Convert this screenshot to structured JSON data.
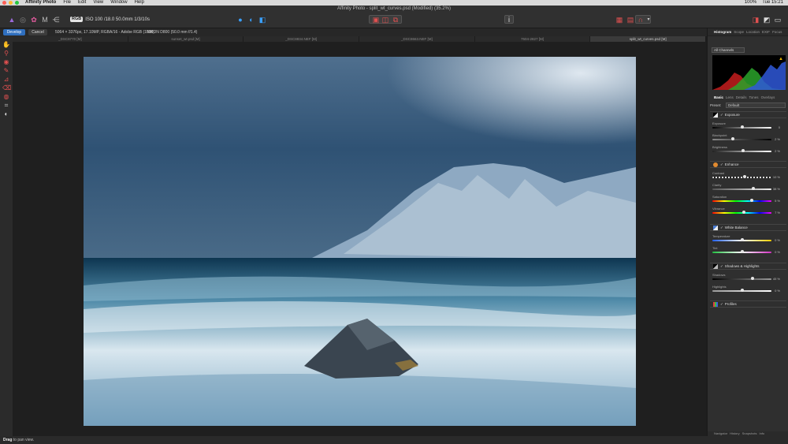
{
  "colors": {
    "accent": "#2f6fbf",
    "close": "#ff5f57",
    "minimize": "#febc2e",
    "zoom": "#28c840"
  },
  "menubar": {
    "app_name": "Affinity Photo",
    "items": [
      "File",
      "Edit",
      "View",
      "Window",
      "Help"
    ],
    "battery": "100%",
    "clock": "Tue 15:21"
  },
  "window": {
    "title": "Affinity Photo - split_wt_curves.psd (Modified) (35.2%)"
  },
  "toolbar": {
    "color_badge": "RGB",
    "exif": "ISO 100 /18.0 50.0mm 1/3/10s"
  },
  "context": {
    "develop_label": "Develop",
    "cancel_label": "Cancel",
    "image_info": "5064 × 3376px, 17.10MP, RGBA/16 - Adobe RGB (1998)",
    "camera_info": "NIKON D800 (50.0 mm f/1.4)"
  },
  "tabs": [
    {
      "label": "_DSC8770 [M]"
    },
    {
      "label": "sunset_wt.psd [M]"
    },
    {
      "label": "_DSC8834.NEF [M]"
    },
    {
      "label": "_DSC8663.NEF [M]"
    },
    {
      "label": "7504-2827 [M]"
    },
    {
      "label": "split_wt_curves.psd [M]"
    }
  ],
  "statusbar": {
    "bold": "Drag",
    "text": " to pan view."
  },
  "panel": {
    "top_tabs": [
      "Histogram",
      "Scope",
      "Location",
      "EXIF",
      "Focus"
    ],
    "channels": "All Channels",
    "dev_tabs": [
      "Basic",
      "Lens",
      "Details",
      "Tones",
      "Overlays"
    ],
    "preset_label": "Preset:",
    "preset_value": "Default",
    "sections": [
      {
        "name": "Exposure",
        "swatch": "#e0e0e0",
        "sliders": [
          {
            "label": "Exposure",
            "value": "0",
            "pos": 0.5,
            "grad": "linear-gradient(90deg,#000,#fff)"
          },
          {
            "label": "Blackpoint",
            "value": "2 %",
            "pos": 0.35,
            "grad": "linear-gradient(90deg,#888,#000)"
          },
          {
            "label": "Brightness",
            "value": "2 %",
            "pos": 0.52,
            "grad": "linear-gradient(90deg,#222,#fff)"
          }
        ]
      },
      {
        "name": "Enhance",
        "swatch": "#e08a30",
        "sliders": [
          {
            "label": "Contrast",
            "value": "10 %",
            "pos": 0.55,
            "grad": "repeating-linear-gradient(90deg,#ddd 0 2px,#222 2px 4px)"
          },
          {
            "label": "Clarity",
            "value": "38 %",
            "pos": 0.69,
            "grad": "linear-gradient(90deg,#555,#eee)"
          },
          {
            "label": "Saturation",
            "value": "5 %",
            "pos": 0.67,
            "grad": "linear-gradient(90deg,#f00,#ff0,#0f0,#0ff,#00f,#f0f)"
          },
          {
            "label": "Vibrance",
            "value": "7 %",
            "pos": 0.53,
            "grad": "linear-gradient(90deg,#f00,#ff0,#0f0,#0ff,#00f,#f0f)"
          }
        ]
      },
      {
        "name": "White Balance",
        "swatch": "#d0d8e8",
        "sliders": [
          {
            "label": "Temperature",
            "value": "0 %",
            "pos": 0.5,
            "grad": "linear-gradient(90deg,#2060ff,#fff,#ffd000)"
          },
          {
            "label": "Tint",
            "value": "0 %",
            "pos": 0.5,
            "grad": "linear-gradient(90deg,#20c040,#fff,#d030c0)"
          }
        ]
      },
      {
        "name": "Shadows & Highlights",
        "swatch": "#bbbbbb",
        "sliders": [
          {
            "label": "Shadows",
            "value": "45 %",
            "pos": 0.68,
            "grad": "linear-gradient(90deg,#000,#999)"
          },
          {
            "label": "Highlights",
            "value": "0 %",
            "pos": 0.5,
            "grad": "linear-gradient(90deg,#999,#fff)"
          }
        ]
      },
      {
        "name": "Profiles",
        "swatch": "#8a8a8a",
        "sliders": []
      }
    ],
    "bottom_tabs": [
      "Navigator",
      "History",
      "Snapshots",
      "Info"
    ]
  }
}
